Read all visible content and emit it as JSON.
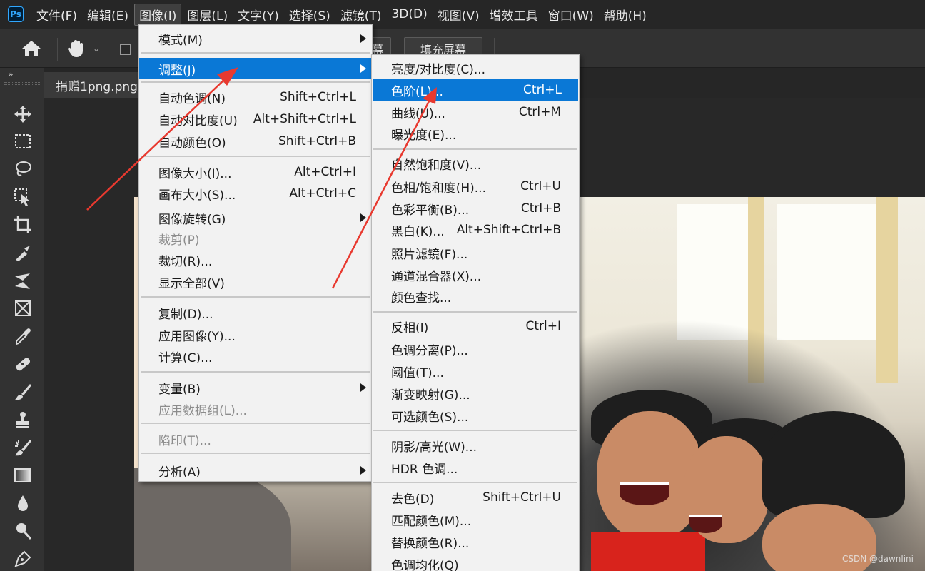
{
  "app": {
    "logo": "Ps"
  },
  "menubar": {
    "items": [
      {
        "label": "文件(F)"
      },
      {
        "label": "编辑(E)"
      },
      {
        "label": "图像(I)"
      },
      {
        "label": "图层(L)"
      },
      {
        "label": "文字(Y)"
      },
      {
        "label": "选择(S)"
      },
      {
        "label": "滤镜(T)"
      },
      {
        "label": "3D(D)"
      },
      {
        "label": "视图(V)"
      },
      {
        "label": "增效工具"
      },
      {
        "label": "窗口(W)"
      },
      {
        "label": "帮助(H)"
      }
    ],
    "active_index": 2
  },
  "options_bar": {
    "partial_button_label": "幕",
    "fill_screen_label": "填充屏幕"
  },
  "document": {
    "tab_title": "捐赠1png.png"
  },
  "image_menu": {
    "items": [
      {
        "label": "模式(M)",
        "shortcut": "",
        "submenu": true,
        "disabled": false
      },
      {
        "label": "调整(J)",
        "shortcut": "",
        "submenu": true,
        "disabled": false,
        "highlighted": true
      },
      {
        "label": "自动色调(N)",
        "shortcut": "Shift+Ctrl+L"
      },
      {
        "label": "自动对比度(U)",
        "shortcut": "Alt+Shift+Ctrl+L"
      },
      {
        "label": "自动颜色(O)",
        "shortcut": "Shift+Ctrl+B"
      },
      {
        "label": "图像大小(I)...",
        "shortcut": "Alt+Ctrl+I"
      },
      {
        "label": "画布大小(S)...",
        "shortcut": "Alt+Ctrl+C"
      },
      {
        "label": "图像旋转(G)",
        "shortcut": "",
        "submenu": true
      },
      {
        "label": "裁剪(P)",
        "shortcut": "",
        "disabled": true
      },
      {
        "label": "裁切(R)...",
        "shortcut": ""
      },
      {
        "label": "显示全部(V)",
        "shortcut": ""
      },
      {
        "label": "复制(D)...",
        "shortcut": ""
      },
      {
        "label": "应用图像(Y)...",
        "shortcut": ""
      },
      {
        "label": "计算(C)...",
        "shortcut": ""
      },
      {
        "label": "变量(B)",
        "shortcut": "",
        "submenu": true
      },
      {
        "label": "应用数据组(L)...",
        "shortcut": "",
        "disabled": true
      },
      {
        "label": "陷印(T)...",
        "shortcut": "",
        "disabled": true
      },
      {
        "label": "分析(A)",
        "shortcut": "",
        "submenu": true
      }
    ]
  },
  "adjust_menu": {
    "items": [
      {
        "label": "亮度/对比度(C)...",
        "shortcut": ""
      },
      {
        "label": "色阶(L)...",
        "shortcut": "Ctrl+L",
        "highlighted": true
      },
      {
        "label": "曲线(U)...",
        "shortcut": "Ctrl+M"
      },
      {
        "label": "曝光度(E)...",
        "shortcut": ""
      },
      {
        "label": "自然饱和度(V)...",
        "shortcut": ""
      },
      {
        "label": "色相/饱和度(H)...",
        "shortcut": "Ctrl+U"
      },
      {
        "label": "色彩平衡(B)...",
        "shortcut": "Ctrl+B"
      },
      {
        "label": "黑白(K)...",
        "shortcut": "Alt+Shift+Ctrl+B"
      },
      {
        "label": "照片滤镜(F)...",
        "shortcut": ""
      },
      {
        "label": "通道混合器(X)...",
        "shortcut": ""
      },
      {
        "label": "颜色查找...",
        "shortcut": ""
      },
      {
        "label": "反相(I)",
        "shortcut": "Ctrl+I"
      },
      {
        "label": "色调分离(P)...",
        "shortcut": ""
      },
      {
        "label": "阈值(T)...",
        "shortcut": ""
      },
      {
        "label": "渐变映射(G)...",
        "shortcut": ""
      },
      {
        "label": "可选颜色(S)...",
        "shortcut": ""
      },
      {
        "label": "阴影/高光(W)...",
        "shortcut": ""
      },
      {
        "label": "HDR 色调...",
        "shortcut": ""
      },
      {
        "label": "去色(D)",
        "shortcut": "Shift+Ctrl+U"
      },
      {
        "label": "匹配颜色(M)...",
        "shortcut": ""
      },
      {
        "label": "替换颜色(R)...",
        "shortcut": ""
      },
      {
        "label": "色调均化(Q)",
        "shortcut": ""
      }
    ]
  },
  "tools": [
    {
      "icon": "move-icon"
    },
    {
      "icon": "marquee-icon"
    },
    {
      "icon": "lasso-icon"
    },
    {
      "icon": "object-select-icon"
    },
    {
      "icon": "crop-icon"
    },
    {
      "icon": "eyedropper-slice-icon"
    },
    {
      "icon": "perspective-icon"
    },
    {
      "icon": "frame-icon"
    },
    {
      "icon": "eyedropper-icon"
    },
    {
      "icon": "healing-icon"
    },
    {
      "icon": "brush-icon"
    },
    {
      "icon": "stamp-icon"
    },
    {
      "icon": "history-brush-icon"
    },
    {
      "icon": "gradient-icon"
    },
    {
      "icon": "blur-icon"
    },
    {
      "icon": "dodge-icon"
    },
    {
      "icon": "pen-icon"
    }
  ],
  "colors": {
    "menu_highlight": "#0a78d6",
    "annotation_arrow": "#e8392f",
    "ui_dark": "#262626",
    "panel": "#323232"
  },
  "watermark": "CSDN @dawnlini"
}
